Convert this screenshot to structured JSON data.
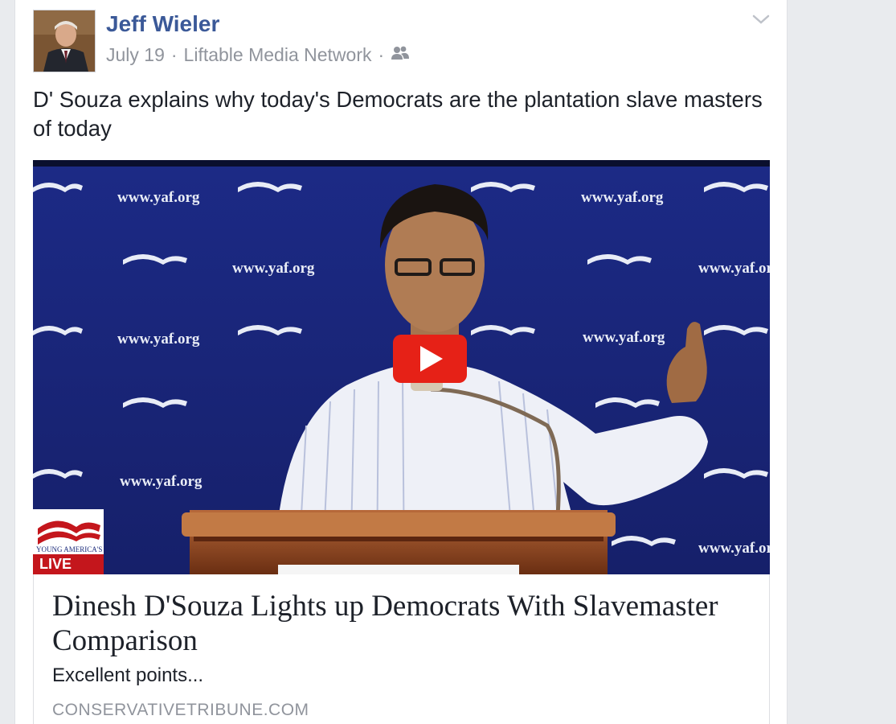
{
  "post": {
    "author": "Jeff Wieler",
    "date": "July 19",
    "page": "Liftable Media Network",
    "audience_icon": "friends-icon",
    "text": "D' Souza explains why today's Democrats are the plantation slave masters of today"
  },
  "video": {
    "backdrop_text": "www.yaf.org",
    "logo_text": "YOUNG AMERICA'S",
    "badge_label": "LIVE",
    "play_icon": "play-icon"
  },
  "link": {
    "title": "Dinesh D'Souza Lights up Democrats With Slavemaster Comparison",
    "description": "Excellent points...",
    "domain": "CONSERVATIVETRIBUNE.COM"
  },
  "colors": {
    "author": "#3b5998",
    "muted": "#90949c",
    "backdrop": "#1d2a7a",
    "play": "#e62117"
  }
}
